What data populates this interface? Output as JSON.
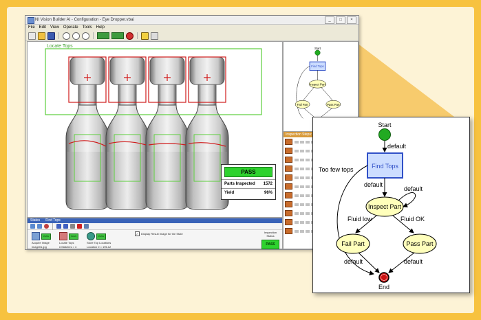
{
  "window": {
    "title": "NI Vision Builder AI - Configuration - Eye Dropper.vbai",
    "controls": [
      "_",
      "□",
      "×"
    ],
    "menu": [
      "File",
      "Edit",
      "View",
      "Operate",
      "Tools",
      "Help"
    ]
  },
  "image_pane": {
    "roi_label": "Locate Tops"
  },
  "results": {
    "status": "PASS",
    "rows": [
      {
        "label": "Parts Inspected",
        "value": "1572"
      },
      {
        "label": "Yield",
        "value": "96%"
      }
    ]
  },
  "state_panel": {
    "tabs": [
      "States",
      "Find Tops"
    ],
    "display_checkbox_label": "Display Result Image for the State",
    "steps": [
      {
        "name": "Acquire Image",
        "detail": "image01.jpg",
        "status": "PASS"
      },
      {
        "name": "Locate Tops",
        "detail": "# Matches = 4",
        "status": "PASS"
      },
      {
        "name": "Store Top Locations",
        "detail": "Location 0 = 196.12",
        "status": "PASS"
      }
    ],
    "inspection_status_label": "Inspection Status",
    "inspection_status_value": "PASS"
  },
  "steps_palette": {
    "header": "Inspection Steps: Check"
  },
  "state_diagram": {
    "nodes": {
      "start": "Start",
      "find_tops": "Find Tops",
      "inspect_part": "Inspect Part",
      "fail_part": "Fail Part",
      "pass_part": "Pass Part",
      "end": "End"
    },
    "edges": {
      "start_to_find": "default",
      "too_few": "Too few tops",
      "find_to_inspect": "default",
      "inspect_loop": "default",
      "fluid_low": "Fluid low",
      "fluid_ok": "Fluid OK",
      "fail_to_end": "default",
      "pass_to_end": "default"
    }
  },
  "colors": {
    "frame": "#f7c23f",
    "background": "#fdf3d6",
    "pass_green": "#2ed22e",
    "node_fill": "#ffffbb",
    "find_tops_blue": "#3050c8",
    "start_green": "#22aa22",
    "end_red": "#cc1111"
  }
}
